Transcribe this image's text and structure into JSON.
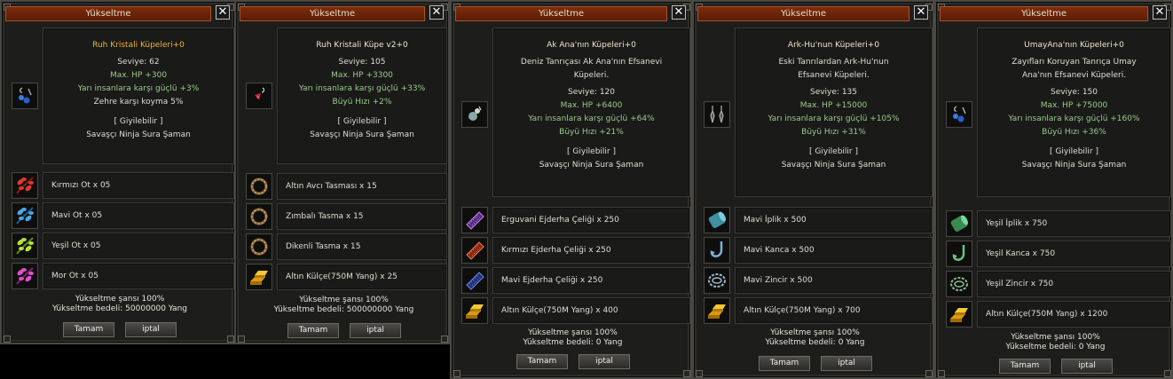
{
  "windows": [
    {
      "title": "Yükseltme",
      "close_label": "✕",
      "item": {
        "name": "Ruh Kristali Küpeleri+0",
        "description": [],
        "level": "Seviye: 62",
        "stats": [
          "Max. HP +300",
          "Yarı insanlara karşı güçlü +3%"
        ],
        "extra_white": [
          "Zehre karşı koyma 5%"
        ],
        "wearable": "[ Giyilebilir ]",
        "classes": "Savaşçı Ninja Sura Şaman",
        "icon": "blue-earring-icon"
      },
      "materials": [
        {
          "label": "Kırmızı Ot x 05",
          "icon": "red-herb-icon"
        },
        {
          "label": "Mavi Ot x 05",
          "icon": "blue-herb-icon"
        },
        {
          "label": "Yeşil Ot x 05",
          "icon": "green-herb-icon"
        },
        {
          "label": "Mor Ot x 05",
          "icon": "purple-herb-icon"
        }
      ],
      "chance": "Yükseltme şansı 100%",
      "cost": "Yükseltme bedeli: 50000000 Yang",
      "ok_label": "Tamam",
      "cancel_label": "iptal"
    },
    {
      "title": "Yükseltme",
      "close_label": "✕",
      "item": {
        "name": "Ruh Kristali Küpe v2+0",
        "description": [],
        "level": "Seviye: 105",
        "stats": [
          "Max. HP +3300",
          "Yarı insanlara karşı güçlü +33%",
          "Büyü Hızı +2%"
        ],
        "extra_white": [],
        "wearable": "[ Giyilebilir ]",
        "classes": "Savaşçı Ninja Sura Şaman",
        "icon": "red-earring-icon"
      },
      "materials": [
        {
          "label": "Altın Avcı Tasması x 15",
          "icon": "bead-collar-icon"
        },
        {
          "label": "Zımbalı Tasma x 15",
          "icon": "bead-collar-icon"
        },
        {
          "label": "Dikenli Tasma x 15",
          "icon": "bead-collar-icon"
        },
        {
          "label": "Altın Külçe(750M Yang) x 25",
          "icon": "gold-bar-icon"
        }
      ],
      "chance": "Yükseltme şansı 100%",
      "cost": "Yükseltme bedeli: 500000000 Yang",
      "ok_label": "Tamam",
      "cancel_label": "iptal"
    },
    {
      "title": "Yükseltme",
      "close_label": "✕",
      "item": {
        "name": "Ak Ana'nın Küpeleri+0",
        "description": [
          "Deniz Tanrıçası Ak Ana'nın Efsanevi",
          "Küpeleri."
        ],
        "level": "Seviye: 120",
        "stats": [
          "Max. HP +6400",
          "Yarı insanlara karşı güçlü +64%",
          "Büyü Hızı +21%"
        ],
        "extra_white": [],
        "wearable": "[ Giyilebilir ]",
        "classes": "Savaşçı Ninja Sura Şaman",
        "icon": "silver-earring-icon"
      },
      "materials": [
        {
          "label": "Erguvani Ejderha Çeliği x 250",
          "icon": "purple-steel-icon"
        },
        {
          "label": "Kırmızı Ejderha Çeliği x 250",
          "icon": "red-steel-icon"
        },
        {
          "label": "Mavi Ejderha Çeliği x 250",
          "icon": "blue-steel-icon"
        },
        {
          "label": "Altın Külçe(750M Yang) x 400",
          "icon": "gold-bar-icon"
        }
      ],
      "chance": "Yükseltme şansı 100%",
      "cost": "Yükseltme bedeli: 0 Yang",
      "ok_label": "Tamam",
      "cancel_label": "iptal"
    },
    {
      "title": "Yükseltme",
      "close_label": "✕",
      "item": {
        "name": "Ark-Hu'nun Küpeleri+0",
        "description": [
          "Eski Tanrılardan Ark-Hu'nun",
          "Efsanevi Küpeleri."
        ],
        "level": "Seviye: 135",
        "stats": [
          "Max. HP +15000",
          "Yarı insanlara karşı güçlü +105%",
          "Büyü Hızı +31%"
        ],
        "extra_white": [],
        "wearable": "[ Giyilebilir ]",
        "classes": "Savaşçı Ninja Sura Şaman",
        "icon": "dark-earring-icon"
      },
      "materials": [
        {
          "label": "Mavi İplik x 500",
          "icon": "blue-thread-icon"
        },
        {
          "label": "Mavi Kanca x 500",
          "icon": "blue-hook-icon"
        },
        {
          "label": "Mavi Zincir x 500",
          "icon": "blue-chain-icon"
        },
        {
          "label": "Altın Külçe(750M Yang) x 700",
          "icon": "gold-bar-icon"
        }
      ],
      "chance": "Yükseltme şansı 100%",
      "cost": "Yükseltme bedeli: 0 Yang",
      "ok_label": "Tamam",
      "cancel_label": "iptal"
    },
    {
      "title": "Yükseltme",
      "close_label": "✕",
      "item": {
        "name": "UmayAna'nın Küpeleri+0",
        "description": [
          "Zayıfları Koruyan Tanrıça Umay",
          "Ana'nın Efsanevi Küpeleri."
        ],
        "level": "Seviye: 150",
        "stats": [
          "Max. HP +75000",
          "Yarı insanlara karşı güçlü +160%",
          "Büyü Hızı +36%"
        ],
        "extra_white": [],
        "wearable": "[ Giyilebilir ]",
        "classes": "Savaşçı Ninja Sura Şaman",
        "icon": "blue-earring-icon"
      },
      "materials": [
        {
          "label": "Yeşil İplik x 750",
          "icon": "green-thread-icon"
        },
        {
          "label": "Yeşil Kanca x 750",
          "icon": "green-hook-icon"
        },
        {
          "label": "Yeşil Zincir x 750",
          "icon": "green-chain-icon"
        },
        {
          "label": "Altın Külçe(750M Yang) x 1200",
          "icon": "gold-bar-icon"
        }
      ],
      "chance": "Yükseltme şansı 100%",
      "cost": "Yükseltme bedeli: 0 Yang",
      "ok_label": "Tamam",
      "cancel_label": "iptal"
    }
  ]
}
